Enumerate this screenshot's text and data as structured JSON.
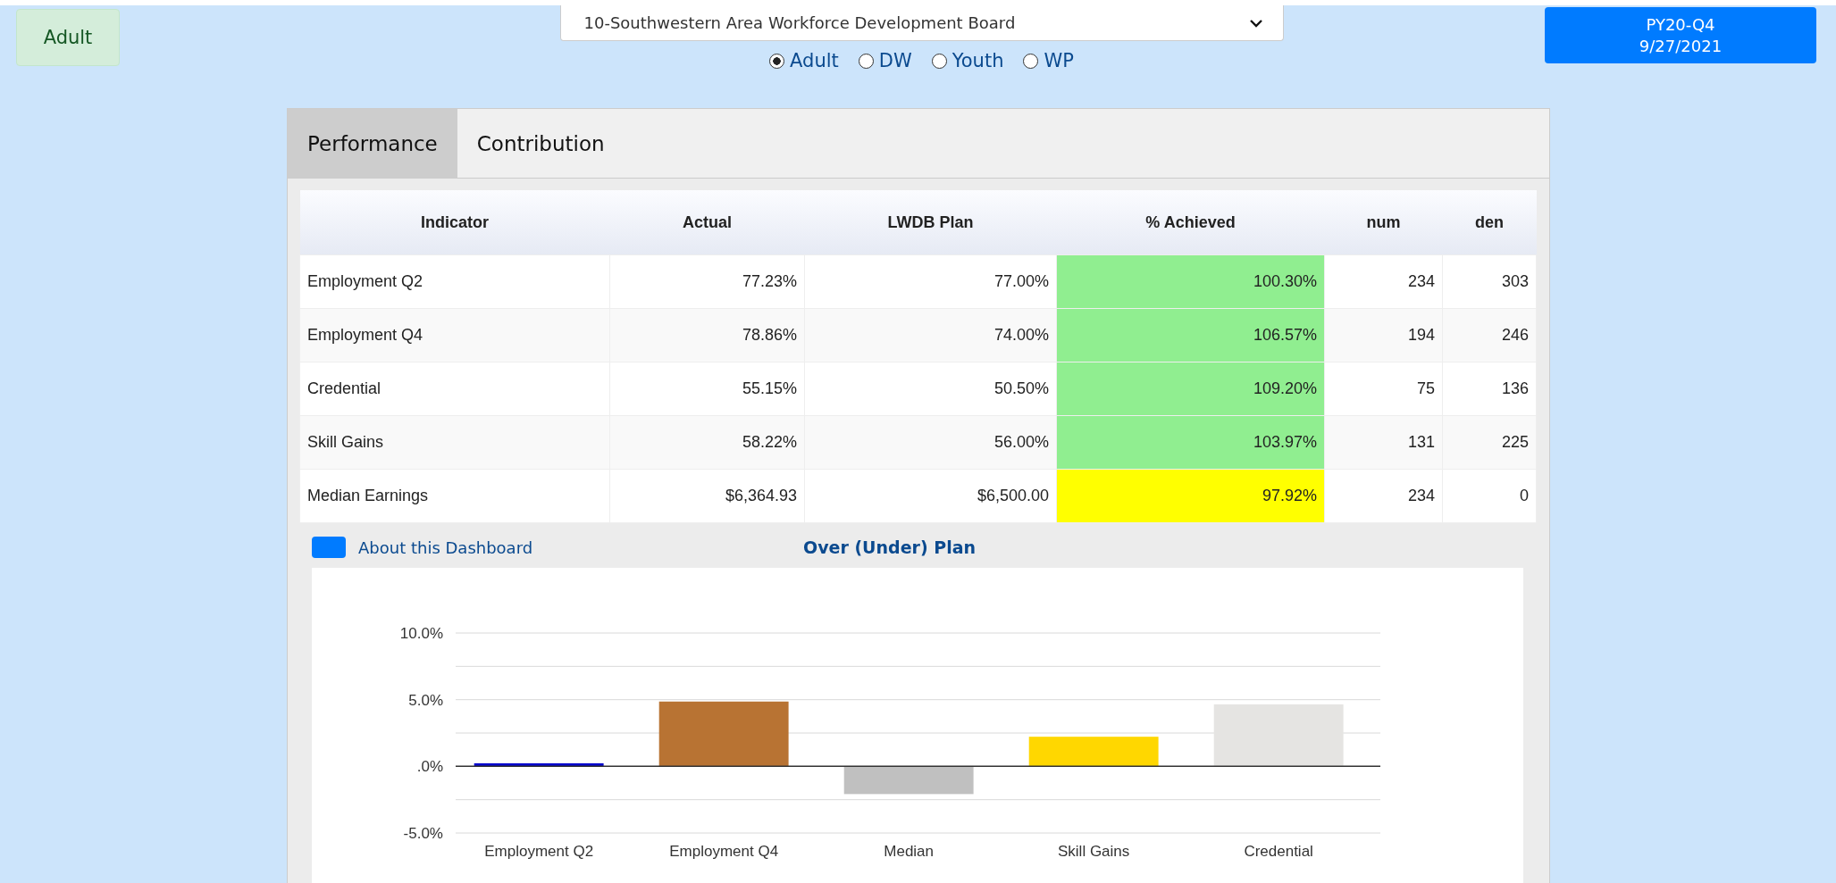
{
  "program_button": {
    "label": "Adult"
  },
  "area_select": {
    "value": "10-Southwestern Area Workforce Development Board"
  },
  "programs": [
    {
      "label": "Adult",
      "selected": true
    },
    {
      "label": "DW",
      "selected": false
    },
    {
      "label": "Youth",
      "selected": false
    },
    {
      "label": "WP",
      "selected": false
    }
  ],
  "period_button": {
    "lines": [
      "PY20-Q4",
      "9/27/2021"
    ]
  },
  "tabs": [
    {
      "label": "Performance",
      "selected": true
    },
    {
      "label": "Contribution",
      "selected": false
    }
  ],
  "table": {
    "columns": [
      "Indicator",
      "Actual",
      "LWDB Plan",
      "% Achieved",
      "num",
      "den"
    ],
    "rows": [
      {
        "cells": [
          "Employment Q2",
          "77.23%",
          "77.00%",
          "100.30%",
          "234",
          "303"
        ],
        "color": "#90ee90"
      },
      {
        "cells": [
          "Employment Q4",
          "78.86%",
          "74.00%",
          "106.57%",
          "194",
          "246"
        ],
        "color": "#90ee90"
      },
      {
        "cells": [
          "Credential",
          "55.15%",
          "50.50%",
          "109.20%",
          "75",
          "136"
        ],
        "color": "#90ee90"
      },
      {
        "cells": [
          "Skill Gains",
          "58.22%",
          "56.00%",
          "103.97%",
          "131",
          "225"
        ],
        "color": "#90ee90"
      },
      {
        "cells": [
          "Median Earnings",
          "$6,364.93",
          "$6,500.00",
          "97.92%",
          "234",
          "0"
        ],
        "color": "#ffff00"
      }
    ]
  },
  "about_link": {
    "label": "About this Dashboard"
  },
  "chart": {
    "bars": [
      {
        "color": "#0000cd"
      },
      {
        "color": "#b87333"
      },
      {
        "color": "#c0c0c0"
      },
      {
        "color": "#ffd700"
      },
      {
        "color": "#e5e4e2"
      }
    ],
    "chart_data": {
      "type": "bar",
      "title": "Over (Under) Plan",
      "categories": [
        "Employment Q2",
        "Employment Q4",
        "Median",
        "Skill Gains",
        "Credential"
      ],
      "values": [
        0.23,
        4.86,
        -2.08,
        2.22,
        4.65
      ],
      "ylim": [
        -5,
        10
      ],
      "yticks": [
        {
          "value": -5,
          "label": "-5.0%"
        },
        {
          "value": 0,
          "label": ".0%"
        },
        {
          "value": 5,
          "label": "5.0%"
        },
        {
          "value": 10,
          "label": "10.0%"
        }
      ]
    }
  }
}
